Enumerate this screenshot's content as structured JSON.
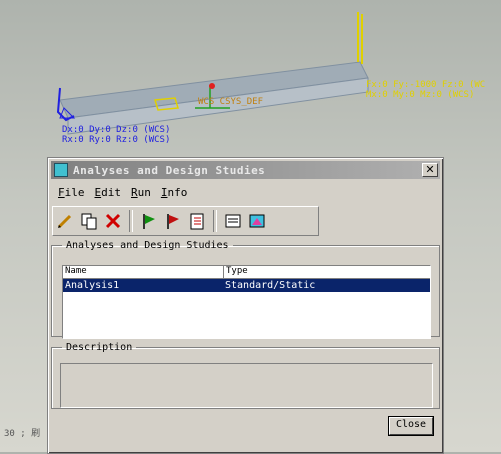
{
  "model": {
    "load_line1": "Fx:0 Fy:-1000 Fz:0 (WC",
    "load_line2": "Mx:0 My:0 Mz:0 (WCS)",
    "cons_line1": "Dx:0 Dy:0 Dz:0 (WCS)",
    "cons_line2": "Rx:0 Ry:0 Rz:0 (WCS)",
    "csys_label": "WCS CSYS_DEF",
    "status": "30 ; 刷"
  },
  "dialog": {
    "title": "Analyses and Design Studies",
    "menu": [
      "File",
      "Edit",
      "Run",
      "Info"
    ],
    "list_group_label": "Analyses and Design Studies",
    "columns": [
      "Name",
      "Type"
    ],
    "rows": [
      {
        "name": "Analysis1",
        "type": "Standard/Static"
      }
    ],
    "description_label": "Description",
    "close_label": "Close"
  },
  "colors": {
    "selection": "#0a246a",
    "load": "#e0d000",
    "constraint": "#2020e0"
  }
}
